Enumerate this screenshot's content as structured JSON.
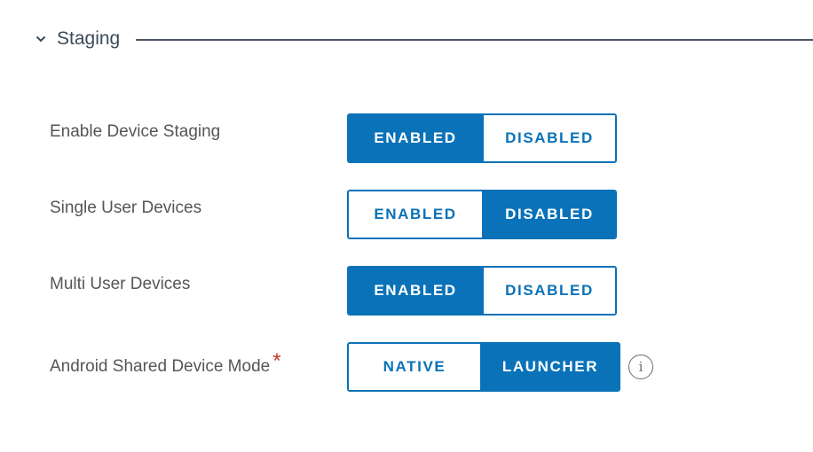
{
  "section": {
    "title": "Staging",
    "toggle_icon": "chevron-down-icon"
  },
  "rows": [
    {
      "label": "Enable Device Staging",
      "required": false,
      "options": [
        "ENABLED",
        "DISABLED"
      ],
      "selected": "ENABLED"
    },
    {
      "label": "Single User Devices",
      "required": false,
      "options": [
        "ENABLED",
        "DISABLED"
      ],
      "selected": "DISABLED"
    },
    {
      "label": "Multi User Devices",
      "required": false,
      "options": [
        "ENABLED",
        "DISABLED"
      ],
      "selected": "ENABLED"
    },
    {
      "label": "Android Shared Device Mode",
      "required": true,
      "required_mark": "*",
      "options": [
        "NATIVE",
        "LAUNCHER"
      ],
      "selected": "LAUNCHER",
      "info_icon": "info-icon",
      "info_glyph": "i"
    }
  ],
  "colors": {
    "accent": "#0a72b8",
    "required": "#c0392b",
    "label": "#565656"
  }
}
